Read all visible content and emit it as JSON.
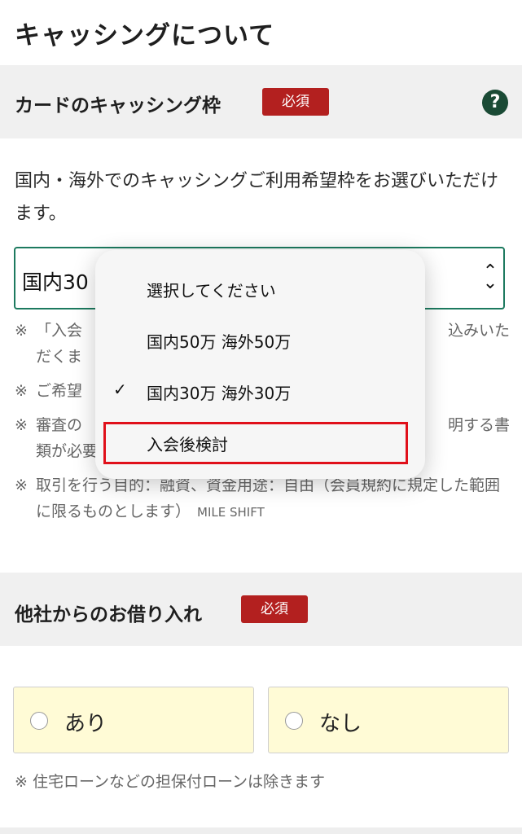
{
  "page": {
    "title": "キャッシングについて"
  },
  "card_cashing": {
    "title": "カードのキャッシング枠",
    "required_badge": "必須",
    "help_icon": "question-circle-icon",
    "description": "国内・海外でのキャッシングご利用希望枠をお選びいただけます。",
    "select": {
      "value": "国内30万 海外30万",
      "visible_value": "国内30"
    },
    "notes": [
      {
        "mark": "※",
        "visible_start": "「入会",
        "visible_end": "込みいた",
        "visible_line2": "だくま"
      },
      {
        "mark": "※",
        "visible_start": "ご希望"
      },
      {
        "mark": "※",
        "visible_start": "審査の",
        "visible_end": "明する書",
        "visible_line2": "類が必要"
      },
      {
        "mark": "※",
        "text": "取引を行う目的：融資、資金用途：自由（会員規約に規定した範囲に限るものとします）",
        "suffix": "MILE SHIFT"
      }
    ]
  },
  "dropdown": {
    "options": [
      {
        "label": "選択してください",
        "checked": false
      },
      {
        "label": "国内50万 海外50万",
        "checked": false
      },
      {
        "label": "国内30万 海外30万",
        "checked": true
      },
      {
        "label": "入会後検討",
        "checked": false,
        "highlighted": true
      }
    ],
    "check_mark": "✓"
  },
  "other_loans": {
    "title": "他社からのお借り入れ",
    "required_badge": "必須",
    "options": [
      {
        "label": "あり",
        "selected": false
      },
      {
        "label": "なし",
        "selected": false
      }
    ],
    "note": "※ 住宅ローンなどの担保付ローンは除きます"
  },
  "colors": {
    "badge": "#b3201f",
    "select_border": "#1d7a5f",
    "help_icon": "#1a4a35",
    "radio_bg": "#fffbd6",
    "highlight": "#e0101a"
  }
}
